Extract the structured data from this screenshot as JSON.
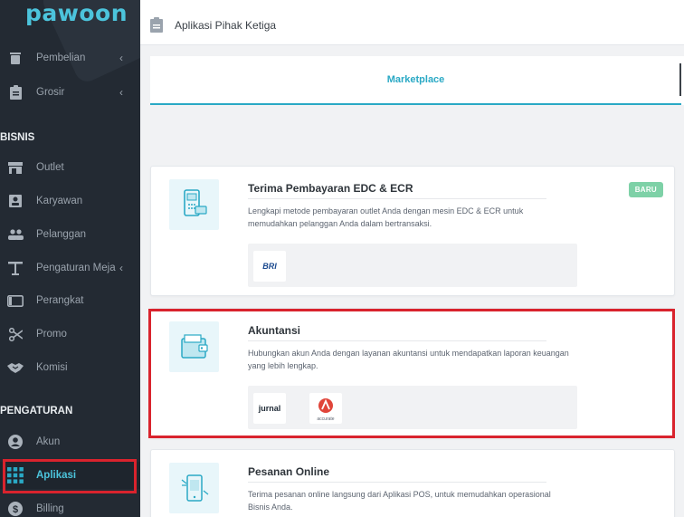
{
  "app": {
    "logo": "pawoon"
  },
  "sidebar": {
    "items_top": [
      {
        "label": "Pembelian",
        "icon": "trash-icon",
        "chevron": "‹"
      },
      {
        "label": "Grosir",
        "icon": "clipboard-icon",
        "chevron": "‹"
      }
    ],
    "section_bisnis": "BISNIS",
    "bisnis_items": [
      {
        "label": "Outlet",
        "icon": "store-icon"
      },
      {
        "label": "Karyawan",
        "icon": "id-badge-icon"
      },
      {
        "label": "Pelanggan",
        "icon": "people-icon"
      },
      {
        "label": "Pengaturan Meja",
        "icon": "table-icon",
        "chevron": "‹"
      },
      {
        "label": "Perangkat",
        "icon": "tablet-icon"
      },
      {
        "label": "Promo",
        "icon": "scissors-icon"
      },
      {
        "label": "Komisi",
        "icon": "handshake-icon"
      }
    ],
    "section_pengaturan": "PENGATURAN",
    "pengaturan_items": [
      {
        "label": "Akun",
        "icon": "user-circle-icon"
      },
      {
        "label": "Aplikasi",
        "icon": "grid-icon"
      },
      {
        "label": "Billing",
        "icon": "dollar-icon"
      }
    ]
  },
  "header": {
    "title": "Aplikasi Pihak Ketiga"
  },
  "tabs": [
    {
      "label": "Marketplace"
    }
  ],
  "cards": [
    {
      "title": "Terima Pembayaran EDC & ECR",
      "badge": "BARU",
      "description": "Lengkapi metode pembayaran outlet Anda dengan mesin EDC & ECR untuk memudahkan pelanggan Anda dalam bertransaksi.",
      "partners": [
        {
          "name": "BRI"
        }
      ]
    },
    {
      "title": "Akuntansi",
      "description": "Hubungkan akun Anda dengan layanan akuntansi untuk mendapatkan laporan keuangan yang lebih lengkap.",
      "partners": [
        {
          "name": "jurnal"
        },
        {
          "name": "accurate"
        }
      ]
    },
    {
      "title": "Pesanan Online",
      "description": "Terima pesanan online langsung dari Aplikasi POS, untuk memudahkan operasional Bisnis Anda."
    }
  ],
  "colors": {
    "accent": "#2aa9c5",
    "sidebar_bg": "#232a33",
    "highlight_red": "#d9232d",
    "badge_green": "#7ed1a7"
  }
}
